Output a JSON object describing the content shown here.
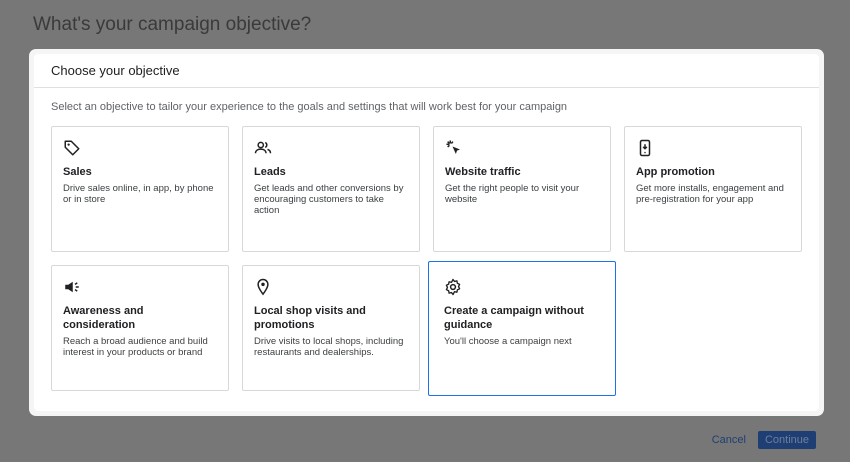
{
  "background": {
    "title": "What's your campaign objective?",
    "cancel_label": "Cancel",
    "continue_label": "Continue"
  },
  "dialog": {
    "title": "Choose your objective",
    "description": "Select an objective to tailor your experience to the goals and settings that will work best for your campaign"
  },
  "objectives": [
    {
      "title": "Sales",
      "description": "Drive sales online, in app, by phone or in store",
      "icon": "tag-icon"
    },
    {
      "title": "Leads",
      "description": "Get leads and other conversions by encouraging customers to take action",
      "icon": "people-icon"
    },
    {
      "title": "Website traffic",
      "description": "Get the right people to visit your website",
      "icon": "cursor-click-icon"
    },
    {
      "title": "App promotion",
      "description": "Get more installs, engagement and pre-registration for your app",
      "icon": "phone-icon"
    },
    {
      "title": "Awareness and consideration",
      "description": "Reach a broad audience and build interest in your products or brand",
      "icon": "megaphone-icon"
    },
    {
      "title": "Local shop visits and promotions",
      "description": "Drive visits to local shops, including restaurants and dealerships.",
      "icon": "location-pin-icon"
    },
    {
      "title": "Create a campaign without guidance",
      "description": "You'll choose a campaign next",
      "icon": "gear-icon",
      "selected": true
    }
  ],
  "colors": {
    "accent": "#1a73e8",
    "overlay": "#777777"
  }
}
